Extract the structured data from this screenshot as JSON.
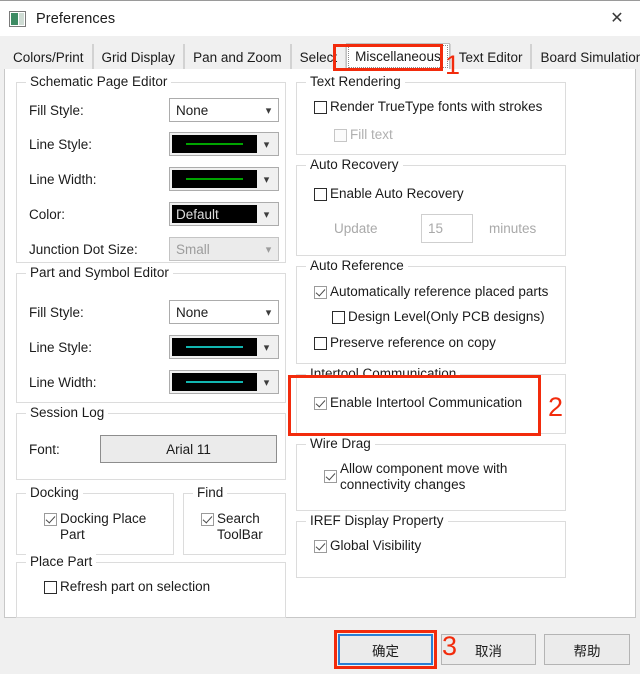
{
  "window": {
    "title": "Preferences",
    "icon": "app-icon",
    "close_label": "✕"
  },
  "tabs": [
    {
      "label": "Colors/Print",
      "active": false
    },
    {
      "label": "Grid Display",
      "active": false
    },
    {
      "label": "Pan and Zoom",
      "active": false
    },
    {
      "label": "Select",
      "active": false
    },
    {
      "label": "Miscellaneous",
      "active": true
    },
    {
      "label": "Text Editor",
      "active": false
    },
    {
      "label": "Board Simulation",
      "active": false
    }
  ],
  "left": {
    "schematic_page_editor": {
      "legend": "Schematic Page Editor",
      "fill_style": {
        "label": "Fill Style:",
        "value": "None"
      },
      "line_style": {
        "label": "Line Style:",
        "value": "",
        "swatch_color": "#00a400"
      },
      "line_width": {
        "label": "Line Width:",
        "value": "",
        "swatch_color": "#00a400"
      },
      "color": {
        "label": "Color:",
        "value": "Default"
      },
      "junction_dot_size": {
        "label": "Junction Dot Size:",
        "value": "Small"
      }
    },
    "part_and_symbol_editor": {
      "legend": "Part and Symbol Editor",
      "fill_style": {
        "label": "Fill Style:",
        "value": "None"
      },
      "line_style": {
        "label": "Line Style:",
        "value": "",
        "swatch_color": "#12b6b0"
      },
      "line_width": {
        "label": "Line Width:",
        "value": "",
        "swatch_color": "#12b6b0"
      }
    },
    "session_log": {
      "legend": "Session Log",
      "font_label": "Font:",
      "font_value": "Arial 11"
    },
    "docking": {
      "legend": "Docking",
      "checkbox": {
        "label": "Docking Place Part",
        "checked": true
      }
    },
    "find": {
      "legend": "Find",
      "checkbox": {
        "label": "Search ToolBar",
        "checked": true
      }
    },
    "place_part": {
      "legend": "Place Part",
      "checkbox": {
        "label": "Refresh part on selection",
        "checked": false
      }
    }
  },
  "right": {
    "text_rendering": {
      "legend": "Text Rendering",
      "render_truetype": {
        "label": "Render TrueType fonts with strokes",
        "checked": false
      },
      "fill_text": {
        "label": "Fill text",
        "checked": false,
        "disabled": true
      }
    },
    "auto_recovery": {
      "legend": "Auto Recovery",
      "enable": {
        "label": "Enable Auto Recovery",
        "checked": false
      },
      "update_label": "Update",
      "update_value": "15",
      "minutes_label": "minutes"
    },
    "auto_reference": {
      "legend": "Auto Reference",
      "auto_ref": {
        "label": "Automatically reference placed parts",
        "checked": true
      },
      "design_level": {
        "label": "Design Level(Only PCB designs)",
        "checked": false
      },
      "preserve": {
        "label": "Preserve reference on copy",
        "checked": false
      }
    },
    "intertool": {
      "legend": "Intertool Communication",
      "enable": {
        "label": "Enable Intertool Communication",
        "checked": true
      }
    },
    "wire_drag": {
      "legend": "Wire Drag",
      "allow": {
        "label": "Allow component move with connectivity changes",
        "checked": true
      }
    },
    "iref": {
      "legend": "IREF Display Property",
      "global_visibility": {
        "label": "Global Visibility",
        "checked": true
      }
    }
  },
  "buttons": {
    "ok": "确定",
    "cancel": "取消",
    "help": "帮助"
  },
  "annotations": {
    "step1": "1",
    "step2": "2",
    "step3": "3",
    "color": "#f22b0c"
  }
}
